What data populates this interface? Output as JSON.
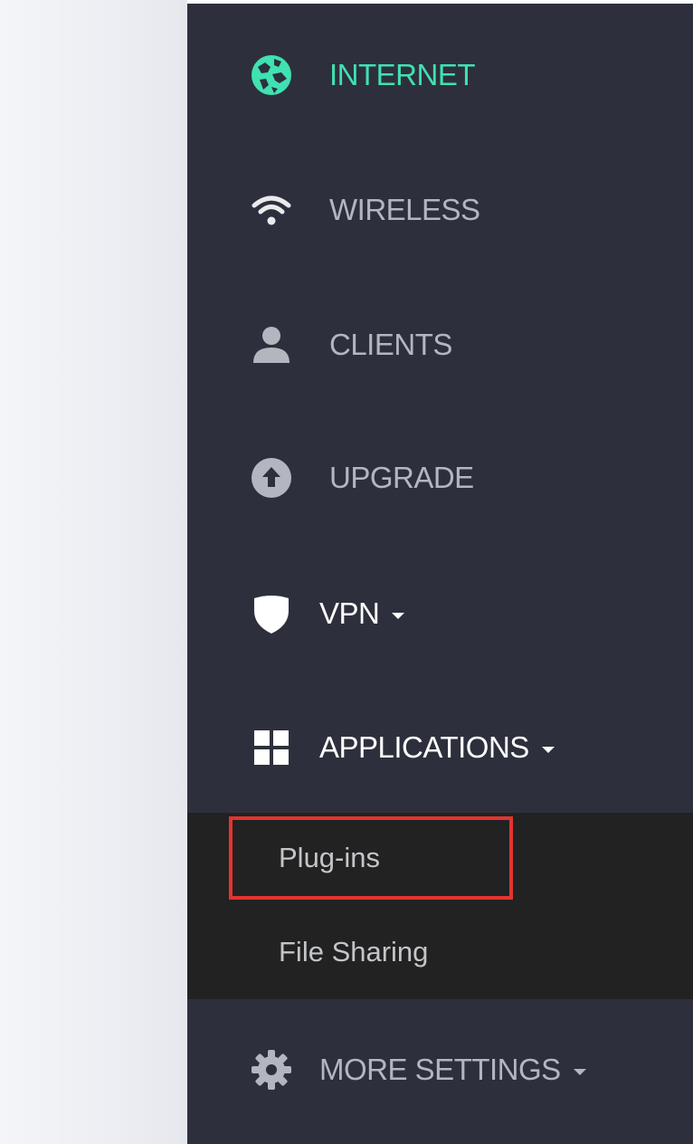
{
  "nav": {
    "items": [
      {
        "label": "INTERNET",
        "icon": "globe-icon",
        "active": true,
        "has_dropdown": false
      },
      {
        "label": "WIRELESS",
        "icon": "wifi-icon",
        "active": false,
        "has_dropdown": false
      },
      {
        "label": "CLIENTS",
        "icon": "user-icon",
        "active": false,
        "has_dropdown": false
      },
      {
        "label": "UPGRADE",
        "icon": "upload-circle-icon",
        "active": false,
        "has_dropdown": false
      },
      {
        "label": "VPN",
        "icon": "shield-icon",
        "active": false,
        "has_dropdown": true
      },
      {
        "label": "APPLICATIONS",
        "icon": "grid-icon",
        "active": false,
        "has_dropdown": true,
        "expanded": true
      },
      {
        "label": "MORE SETTINGS",
        "icon": "gear-icon",
        "active": false,
        "has_dropdown": true
      }
    ],
    "applications_submenu": [
      {
        "label": "Plug-ins",
        "highlighted": true
      },
      {
        "label": "File Sharing",
        "highlighted": false
      }
    ]
  },
  "colors": {
    "sidebar_bg": "#2d303c",
    "submenu_bg": "#222222",
    "active_accent": "#3fe2b0",
    "inactive_text": "#b3b6bf",
    "highlight_border": "#e3342f"
  }
}
